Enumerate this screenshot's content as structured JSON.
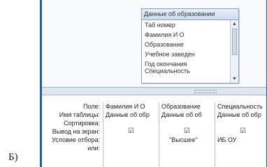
{
  "labels": {
    "bottom": "Б)",
    "top": ""
  },
  "table": {
    "title": "Данные об образовании",
    "fields": [
      "Таб номер",
      "Фамилия И О",
      "Образование",
      "Учебное заведен",
      "Год окончания",
      "Специальность"
    ]
  },
  "grid": {
    "row_labels": [
      "Поле:",
      "Имя таблицы:",
      "Сортировка:",
      "Вывод на экран:",
      "Условие отбора:",
      "или:"
    ],
    "columns": [
      {
        "field": "Фамилия И О",
        "table": "Данные об обр",
        "sort": "",
        "show_icon": "checked-checkbox-icon",
        "criteria": ""
      },
      {
        "field": "Образование",
        "table": "Данные об об",
        "sort": "",
        "show_icon": "checked-checkbox-icon",
        "criteria": "\"Высшее\""
      },
      {
        "field": "Специальность",
        "table": "Данные об обр",
        "sort": "",
        "show_icon": "checked-checkbox-icon",
        "criteria": "ИБ ОУ"
      }
    ]
  },
  "colors": {
    "accent": "#1e5fae",
    "background": "#f4f7fb"
  }
}
